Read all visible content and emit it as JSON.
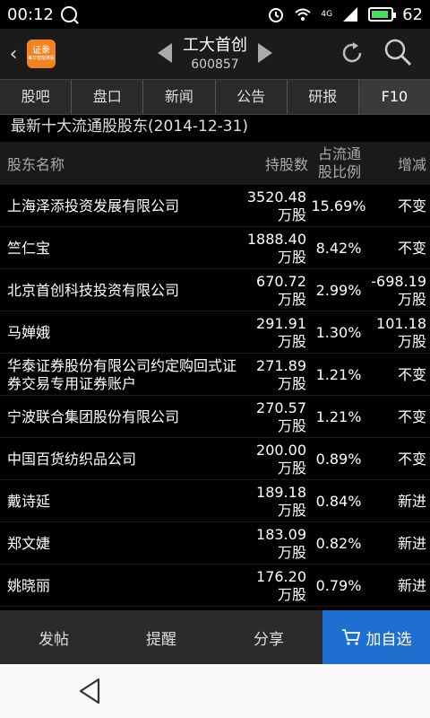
{
  "status": {
    "time": "00:12",
    "battery": "62",
    "network": "4G"
  },
  "header": {
    "stock_name": "工大首创",
    "stock_code": "600857",
    "logo_text": "证豢",
    "logo_sub": "每日智能推股"
  },
  "tabs": [
    "股吧",
    "盘口",
    "新闻",
    "公告",
    "研报",
    "F10"
  ],
  "section": {
    "title": "最新十大流通股股东(2014-12-31)"
  },
  "table": {
    "headers": {
      "name": "股东名称",
      "shares": "持股数",
      "pct": "占流通股比例",
      "pct_line1": "占流通",
      "pct_line2": "股比例",
      "change": "增减"
    },
    "rows": [
      {
        "name": "上海泽添投资发展有限公司",
        "shares_num": "3520.48",
        "shares_unit": "万股",
        "pct": "15.69%",
        "chg1": "不变",
        "chg2": ""
      },
      {
        "name": "竺仁宝",
        "shares_num": "1888.40",
        "shares_unit": "万股",
        "pct": "8.42%",
        "chg1": "不变",
        "chg2": ""
      },
      {
        "name": "北京首创科技投资有限公司",
        "shares_num": "670.72",
        "shares_unit": "万股",
        "pct": "2.99%",
        "chg1": "-698.19",
        "chg2": "万股"
      },
      {
        "name": "马婵娥",
        "shares_num": "291.91",
        "shares_unit": "万股",
        "pct": "1.30%",
        "chg1": "101.18",
        "chg2": "万股"
      },
      {
        "name": "华泰证券股份有限公司约定购回式证券交易专用证券账户",
        "shares_num": "271.89",
        "shares_unit": "万股",
        "pct": "1.21%",
        "chg1": "不变",
        "chg2": ""
      },
      {
        "name": "宁波联合集团股份有限公司",
        "shares_num": "270.57",
        "shares_unit": "万股",
        "pct": "1.21%",
        "chg1": "不变",
        "chg2": ""
      },
      {
        "name": "中国百货纺织品公司",
        "shares_num": "200.00",
        "shares_unit": "万股",
        "pct": "0.89%",
        "chg1": "不变",
        "chg2": ""
      },
      {
        "name": "戴诗延",
        "shares_num": "189.18",
        "shares_unit": "万股",
        "pct": "0.84%",
        "chg1": "新进",
        "chg2": ""
      },
      {
        "name": "郑文婕",
        "shares_num": "183.09",
        "shares_unit": "万股",
        "pct": "0.82%",
        "chg1": "新进",
        "chg2": ""
      },
      {
        "name": "姚晓丽",
        "shares_num": "176.20",
        "shares_unit": "万股",
        "pct": "0.79%",
        "chg1": "新进",
        "chg2": ""
      }
    ]
  },
  "toolbar": {
    "post": "发帖",
    "remind": "提醒",
    "share": "分享",
    "add_watch": "加自选"
  },
  "colors": {
    "accent": "#1e6fd0",
    "logo": "#f28321",
    "battery": "#4cd964"
  },
  "icons": [
    "back-icon",
    "prev-arrow-icon",
    "next-arrow-icon",
    "refresh-icon",
    "search-icon",
    "cart-icon",
    "nav-back-icon"
  ]
}
